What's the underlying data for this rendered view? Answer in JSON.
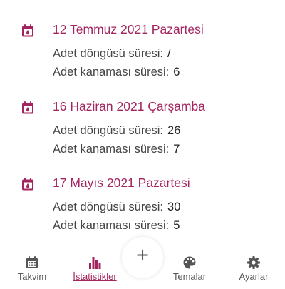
{
  "entries": [
    {
      "date": "12 Temmuz 2021 Pazartesi",
      "cycle_label": "Adet döngüsü süresi:",
      "cycle_value": "/",
      "bleed_label": "Adet kanaması süresi:",
      "bleed_value": "6"
    },
    {
      "date": "16 Haziran 2021 Çarşamba",
      "cycle_label": "Adet döngüsü süresi:",
      "cycle_value": "26",
      "bleed_label": "Adet kanaması süresi:",
      "bleed_value": "7"
    },
    {
      "date": "17 Mayıs 2021 Pazartesi",
      "cycle_label": "Adet döngüsü süresi:",
      "cycle_value": "30",
      "bleed_label": "Adet kanaması süresi:",
      "bleed_value": "5"
    }
  ],
  "tabs": [
    {
      "label": "Takvim",
      "icon": "calendar-icon",
      "active": false
    },
    {
      "label": "İstatistikler",
      "icon": "bar-chart-icon",
      "active": true
    },
    {
      "label": "Temalar",
      "icon": "palette-icon",
      "active": false
    },
    {
      "label": "Ayarlar",
      "icon": "gear-icon",
      "active": false
    }
  ],
  "fab": {
    "symbol": "+"
  },
  "colors": {
    "accent": "#a3245e",
    "text": "#444444",
    "icon": "#555555"
  }
}
